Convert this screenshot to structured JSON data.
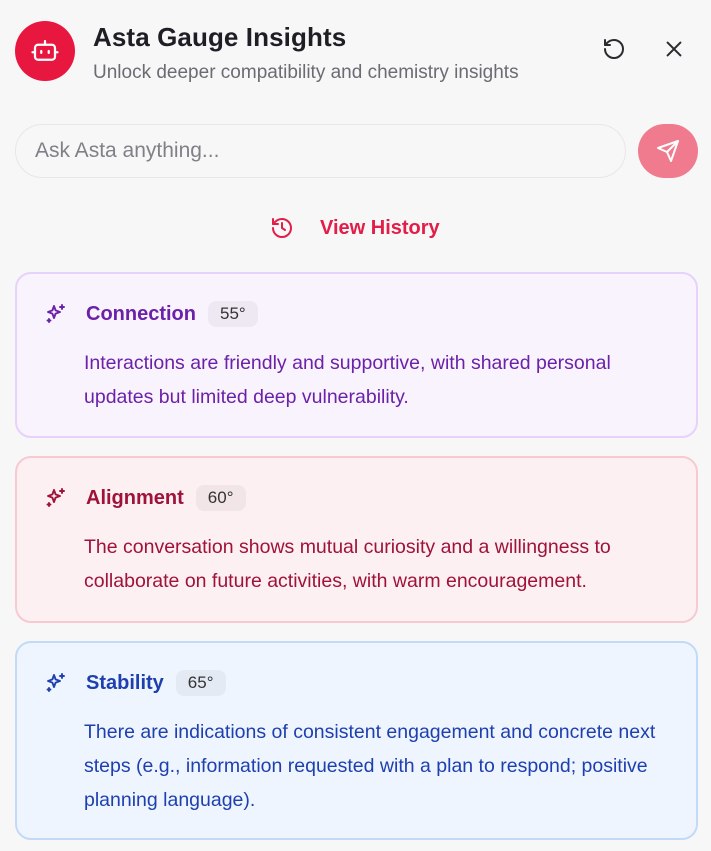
{
  "header": {
    "title": "Asta Gauge Insights",
    "subtitle": "Unlock deeper compatibility and chemistry insights",
    "avatar_icon": "robot-icon",
    "refresh_icon": "refresh-icon",
    "close_icon": "close-icon"
  },
  "search": {
    "placeholder": "Ask Asta anything...",
    "value": "",
    "send_icon": "send-icon"
  },
  "history": {
    "label": "View History",
    "icon": "history-icon"
  },
  "cards": [
    {
      "title": "Connection",
      "badge": "55°",
      "body": "Interactions are friendly and supportive, with shared personal updates but limited deep vulnerability.",
      "icon": "sparkle-icon",
      "color": "#6b21a8"
    },
    {
      "title": "Alignment",
      "badge": "60°",
      "body": "The conversation shows mutual curiosity and a willingness to collaborate on future activities, with warm encouragement.",
      "icon": "sparkle-icon",
      "color": "#9f1239"
    },
    {
      "title": "Stability",
      "badge": "65°",
      "body": "There are indications of consistent engagement and concrete next steps (e.g., information requested with a plan to respond; positive planning language).",
      "icon": "sparkle-icon",
      "color": "#1e40af"
    }
  ],
  "colors": {
    "accent": "#e8173f",
    "send_button": "#f07a8e",
    "history_link": "#e11d48"
  }
}
